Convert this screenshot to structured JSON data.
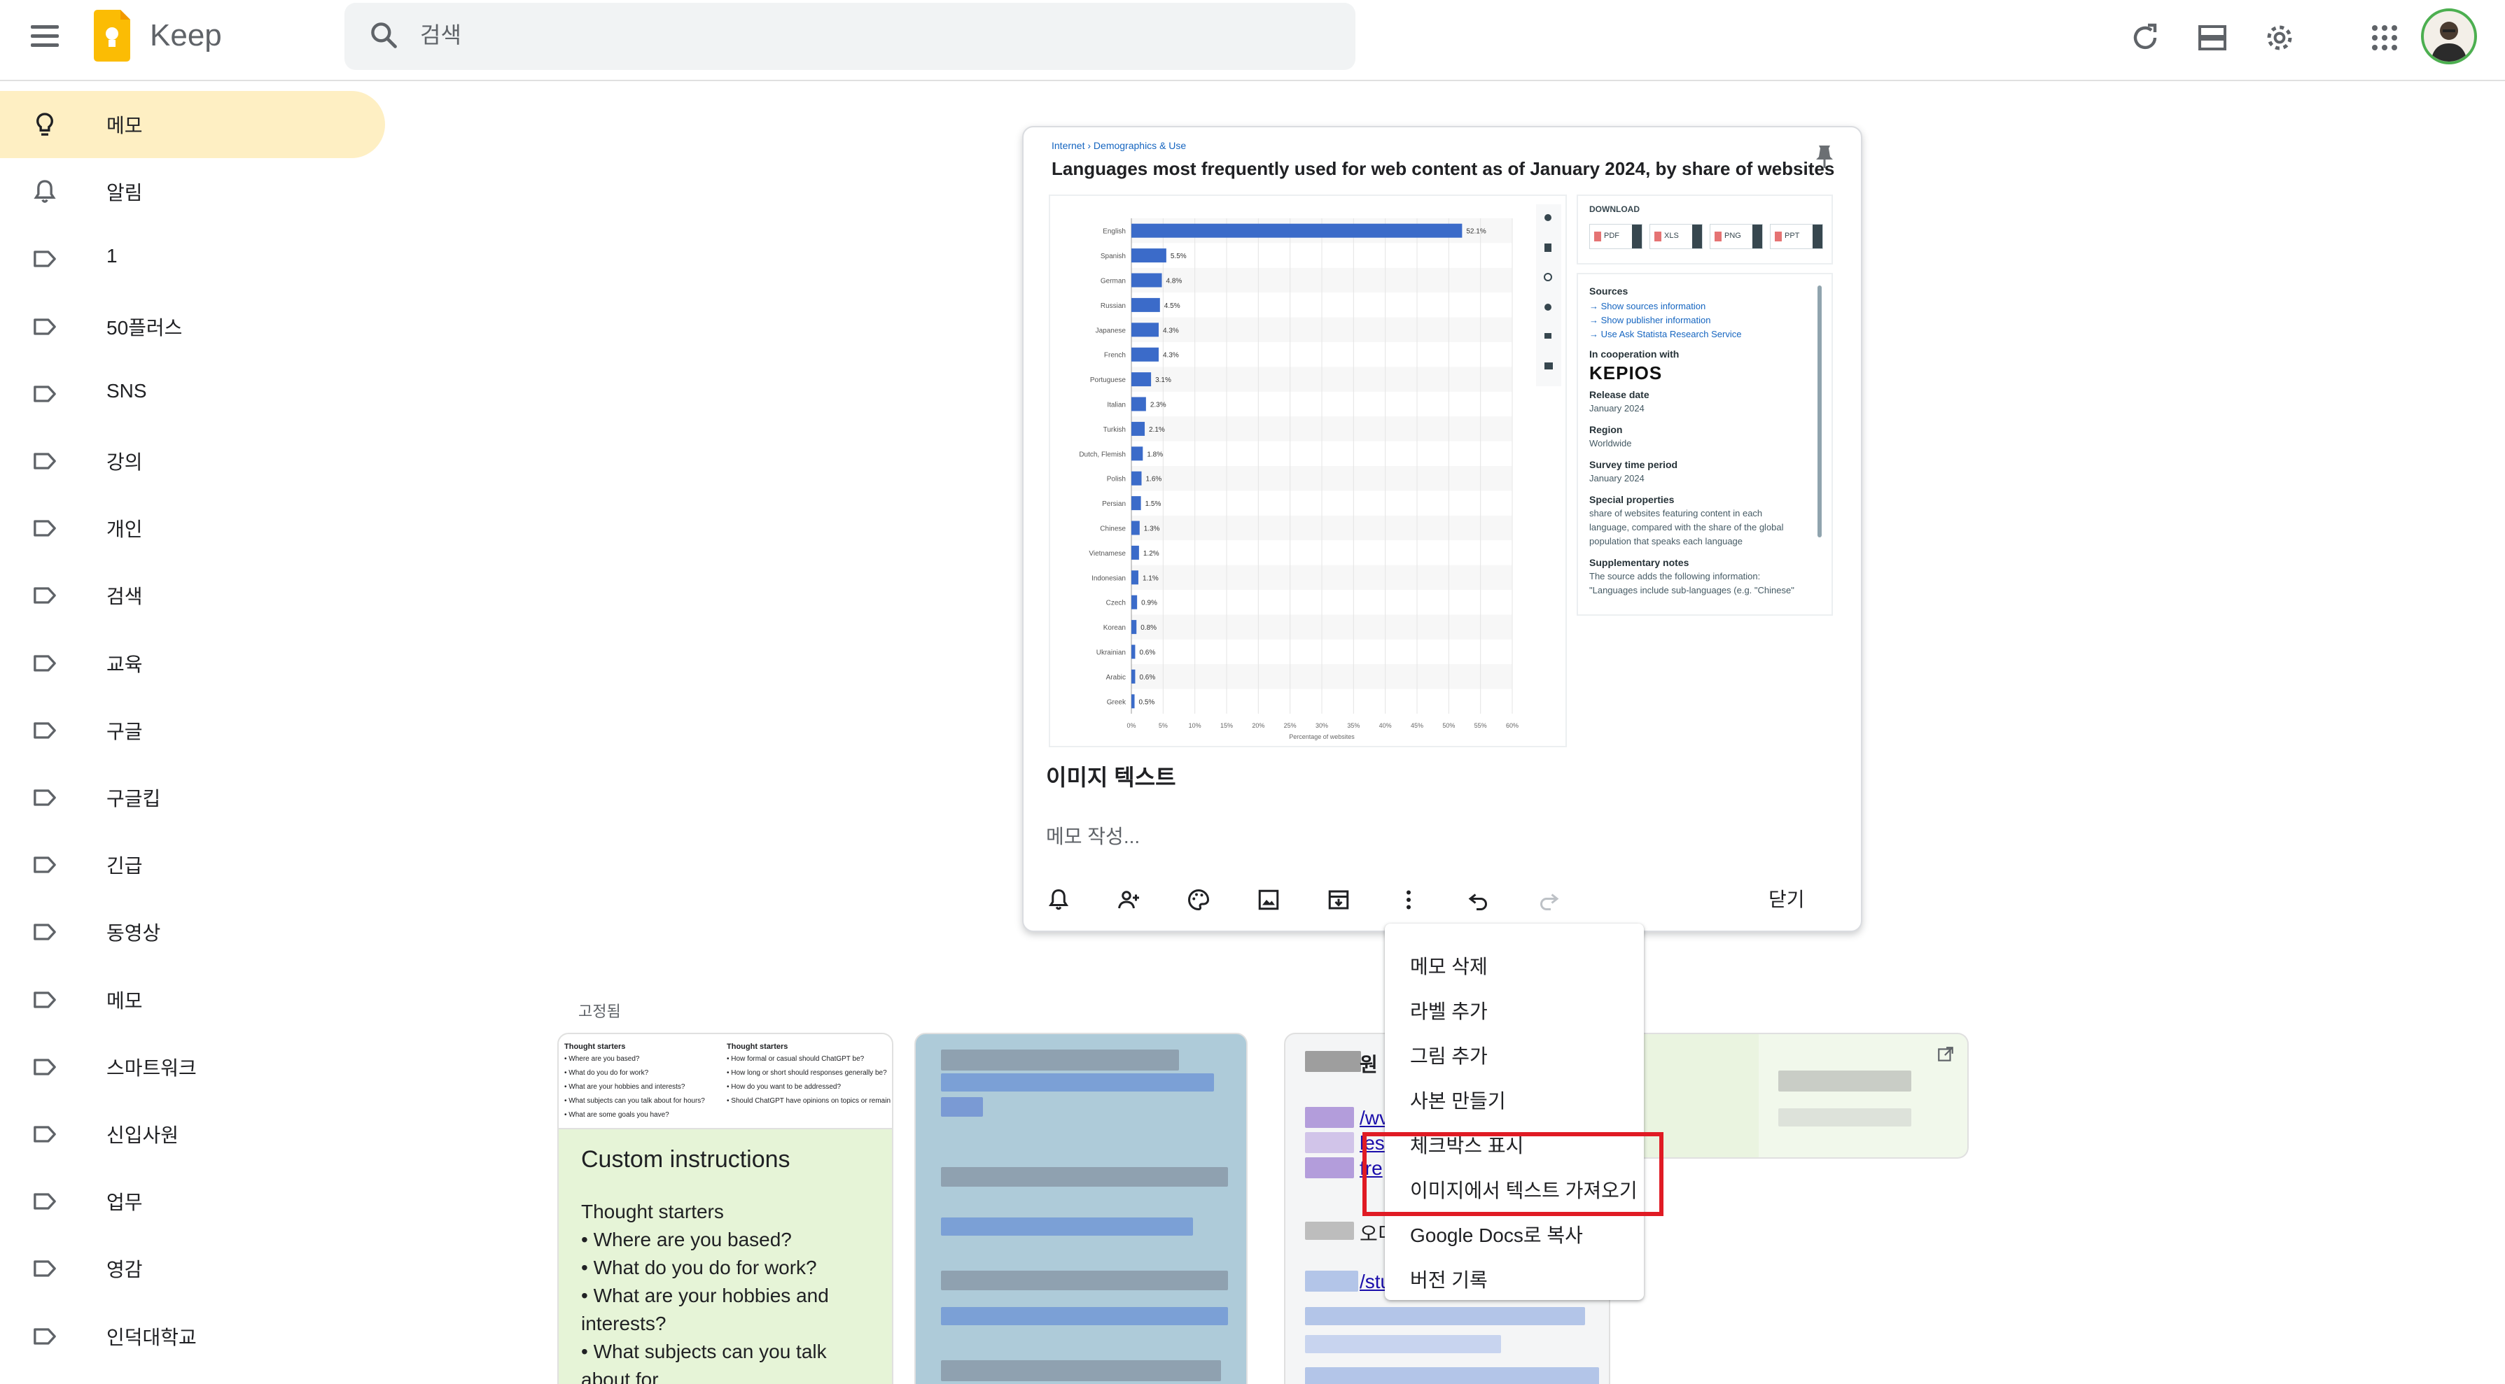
{
  "app": {
    "name": "Keep",
    "search_placeholder": "검색"
  },
  "sidebar": {
    "items": [
      {
        "label": "메모",
        "icon": "lightbulb-icon",
        "active": true
      },
      {
        "label": "알림",
        "icon": "bell-icon"
      },
      {
        "label": "1",
        "icon": "label-icon"
      },
      {
        "label": "50플러스",
        "icon": "label-icon"
      },
      {
        "label": "SNS",
        "icon": "label-icon"
      },
      {
        "label": "강의",
        "icon": "label-icon"
      },
      {
        "label": "개인",
        "icon": "label-icon"
      },
      {
        "label": "검색",
        "icon": "label-icon"
      },
      {
        "label": "교육",
        "icon": "label-icon"
      },
      {
        "label": "구글",
        "icon": "label-icon"
      },
      {
        "label": "구글킵",
        "icon": "label-icon"
      },
      {
        "label": "긴급",
        "icon": "label-icon"
      },
      {
        "label": "동영상",
        "icon": "label-icon"
      },
      {
        "label": "메모",
        "icon": "label-icon"
      },
      {
        "label": "스마트워크",
        "icon": "label-icon"
      },
      {
        "label": "신입사원",
        "icon": "label-icon"
      },
      {
        "label": "업무",
        "icon": "label-icon"
      },
      {
        "label": "영감",
        "icon": "label-icon"
      },
      {
        "label": "인덕대학교",
        "icon": "label-icon"
      }
    ]
  },
  "note": {
    "title": "이미지 텍스트",
    "body_placeholder": "메모 작성...",
    "close_label": "닫기",
    "toolbar_icons": [
      "add-alert-icon",
      "collaborator-icon",
      "palette-icon",
      "image-icon",
      "archive-icon",
      "more-vert-icon",
      "undo-icon",
      "redo-icon"
    ],
    "image": {
      "breadcrumb": "Internet › Demographics & Use",
      "title": "Languages most frequently used for web content as of January 2024, by share of websites",
      "download_label": "DOWNLOAD",
      "download_buttons": [
        "PDF",
        "XLS",
        "PNG",
        "PPT"
      ],
      "sources_heading": "Sources",
      "source_links": [
        "Show sources information",
        "Show publisher information",
        "Use Ask Statista Research Service"
      ],
      "coop_heading": "In cooperation with",
      "coop_logo": "KEPIOS",
      "release_heading": "Release date",
      "release_value": "January 2024",
      "region_heading": "Region",
      "region_value": "Worldwide",
      "survey_heading": "Survey time period",
      "survey_value": "January 2024",
      "special_heading": "Special properties",
      "special_lines": [
        "share of websites featuring content in each",
        "language, compared with the share of the global",
        "population that speaks each language"
      ],
      "supp_heading": "Supplementary notes",
      "supp_lines": [
        "The source adds the following information:",
        "\"Languages include sub-languages (e.g. \"Chinese\""
      ],
      "chart": {
        "type": "bar",
        "xlabel": "Percentage of websites",
        "xticks": [
          "0%",
          "5%",
          "10%",
          "15%",
          "20%",
          "25%",
          "30%",
          "35%",
          "40%",
          "45%",
          "50%",
          "55%",
          "60%"
        ],
        "xlim": [
          0,
          60
        ],
        "color": "#3b6bc9",
        "categories": [
          "English",
          "Spanish",
          "German",
          "Russian",
          "Japanese",
          "French",
          "Portuguese",
          "Italian",
          "Turkish",
          "Dutch, Flemish",
          "Polish",
          "Persian",
          "Chinese",
          "Vietnamese",
          "Indonesian",
          "Czech",
          "Korean",
          "Ukrainian",
          "Arabic",
          "Greek"
        ],
        "values": [
          52.1,
          5.5,
          4.8,
          4.5,
          4.3,
          4.3,
          3.1,
          2.3,
          2.1,
          1.8,
          1.6,
          1.5,
          1.3,
          1.2,
          1.1,
          0.9,
          0.8,
          0.6,
          0.6,
          0.5
        ],
        "labels": [
          "52.1%",
          "5.5%",
          "4.8%",
          "4.5%",
          "4.3%",
          "4.3%",
          "3.1%",
          "2.3%",
          "2.1%",
          "1.8%",
          "1.6%",
          "1.5%",
          "1.3%",
          "1.2%",
          "1.1%",
          "0.9%",
          "0.8%",
          "0.6%",
          "0.6%",
          "0.5%"
        ]
      }
    }
  },
  "pinned_label": "고정됨",
  "cards": {
    "green": {
      "thumb_heading_left": "Thought starters",
      "thumb_left": [
        "• Where are you based?",
        "• What do you do for work?",
        "• What are your hobbies and interests?",
        "• What subjects can you talk about for hours?",
        "• What are some goals you have?"
      ],
      "thumb_heading_right": "Thought starters",
      "thumb_right": [
        "• How formal or casual should ChatGPT be?",
        "• How long or short should responses generally be?",
        "• How do you want to be addressed?",
        "• Should ChatGPT have opinions on topics or remain neutral?"
      ],
      "title": "Custom instructions",
      "lines": [
        "Thought starters",
        "• Where are you based?",
        "• What do you do for work?",
        "• What are your hobbies and",
        "interests?",
        "• What subjects can you talk",
        "about for"
      ]
    },
    "gray": {
      "frag1": "원",
      "frag2": "/wv",
      "frag3": "les",
      "frag4": "fre",
      "frag5": "오디",
      "frag6": "/stu"
    }
  },
  "menu": {
    "items": [
      "메모 삭제",
      "라벨 추가",
      "그림 추가",
      "사본 만들기",
      "체크박스 표시",
      "이미지에서 텍스트 가져오기",
      "Google Docs로 복사",
      "버전 기록"
    ],
    "highlight_color": "#e01b24"
  }
}
